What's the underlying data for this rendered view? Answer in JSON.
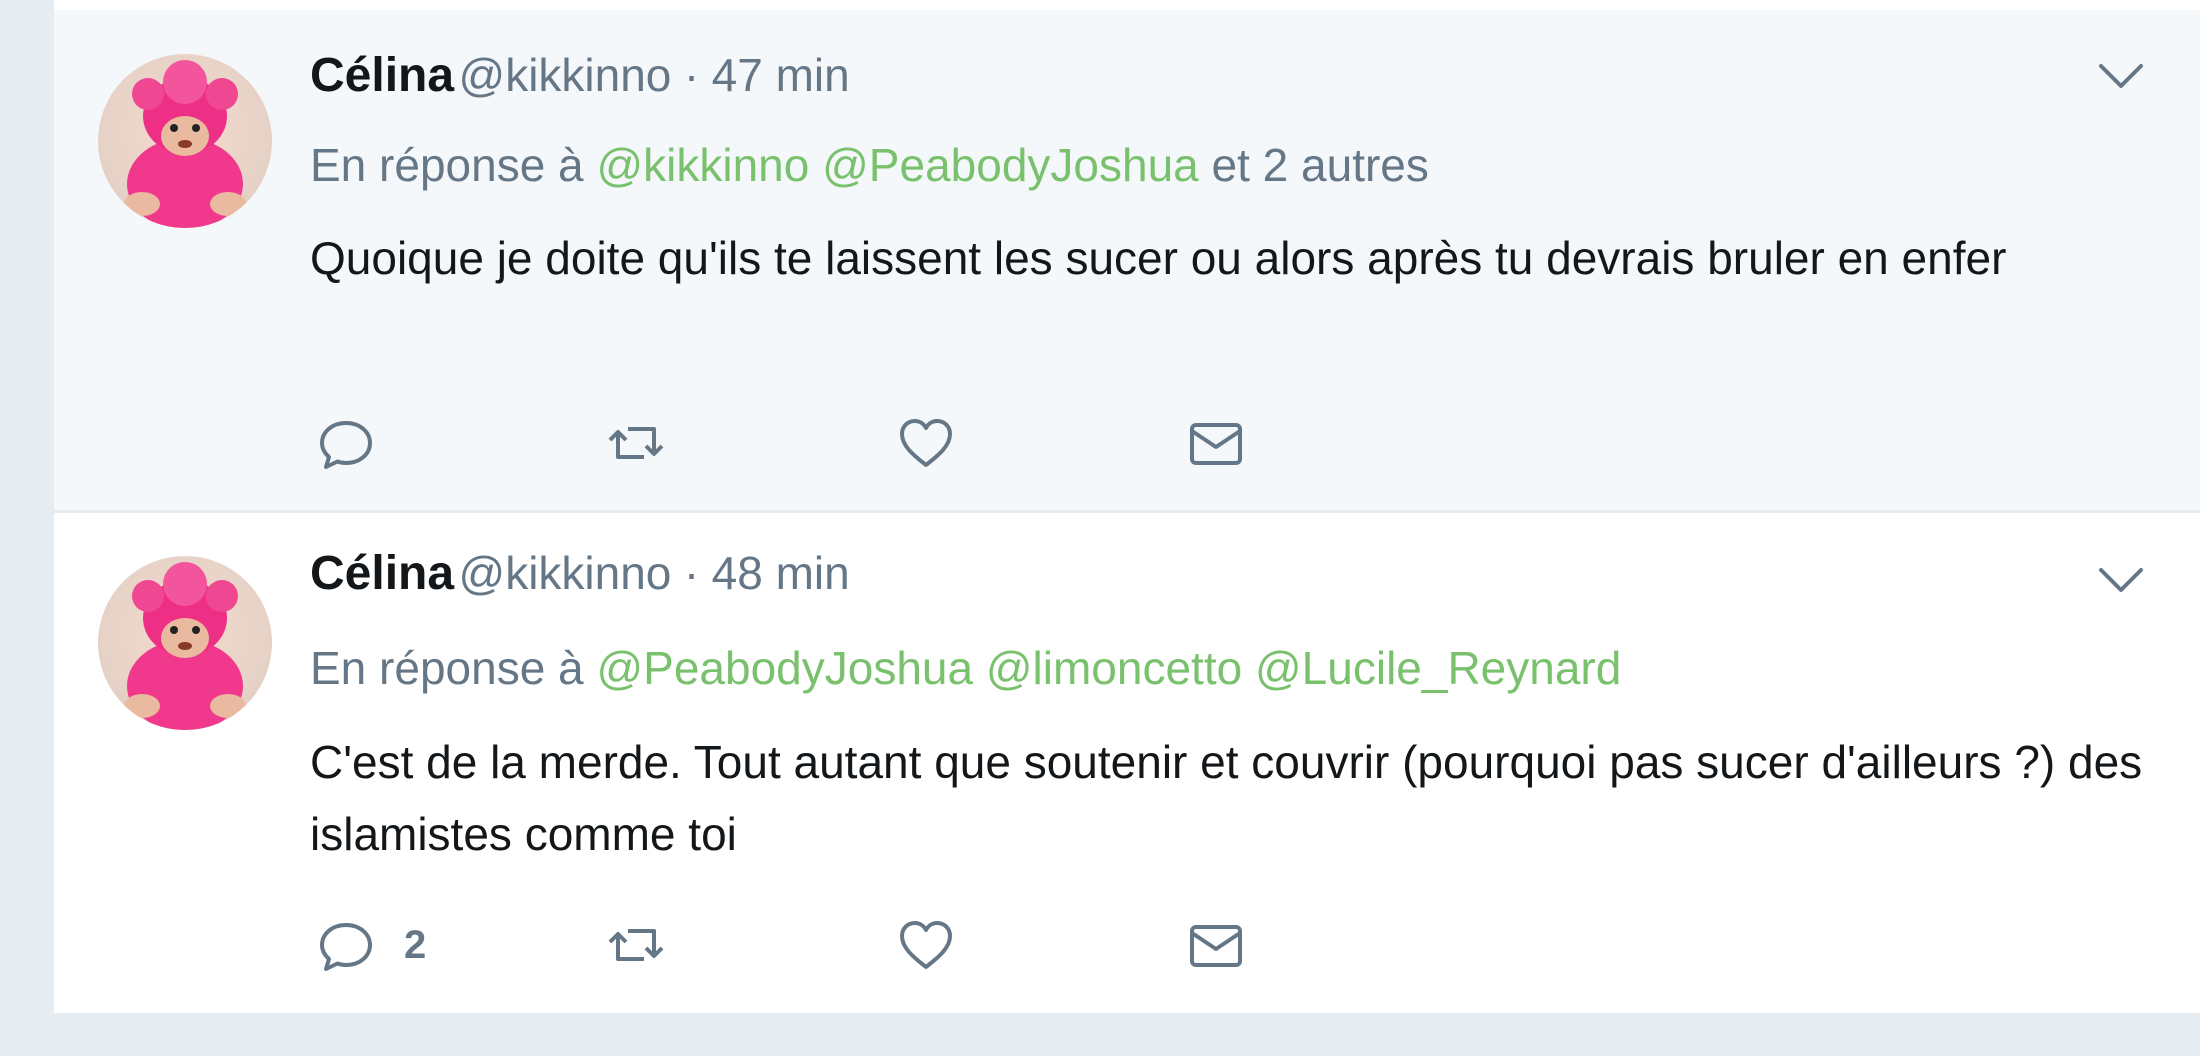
{
  "tweets": [
    {
      "fullname": "Célina",
      "username": "@kikkinno",
      "separator": "·",
      "time": "47 min",
      "reply_prefix": "En réponse à",
      "mentions": [
        "@kikkinno",
        "@PeabodyJoshua"
      ],
      "reply_suffix": "et 2 autres",
      "text": "Quoique je doite qu'ils te laissent les sucer ou alors après tu devrais bruler en enfer",
      "reply_count": ""
    },
    {
      "fullname": "Célina",
      "username": "@kikkinno",
      "separator": "·",
      "time": "48 min",
      "reply_prefix": "En réponse à",
      "mentions": [
        "@PeabodyJoshua",
        "@limoncetto",
        "@Lucile_Reynard"
      ],
      "reply_suffix": "",
      "text": "C'est de la merde. Tout autant que soutenir et couvrir (pourquoi pas sucer d'ailleurs ?) des islamistes comme toi",
      "reply_count": "2"
    }
  ],
  "icons": {
    "reply": "reply-icon",
    "retweet": "retweet-icon",
    "like": "heart-icon",
    "dm": "envelope-icon",
    "caret": "chevron-down-icon"
  },
  "colors": {
    "mention": "#79c16d",
    "muted": "#657786",
    "text": "#14171a",
    "highlight_bg": "#f5f8fa",
    "page_bg": "#e6ecf0"
  }
}
